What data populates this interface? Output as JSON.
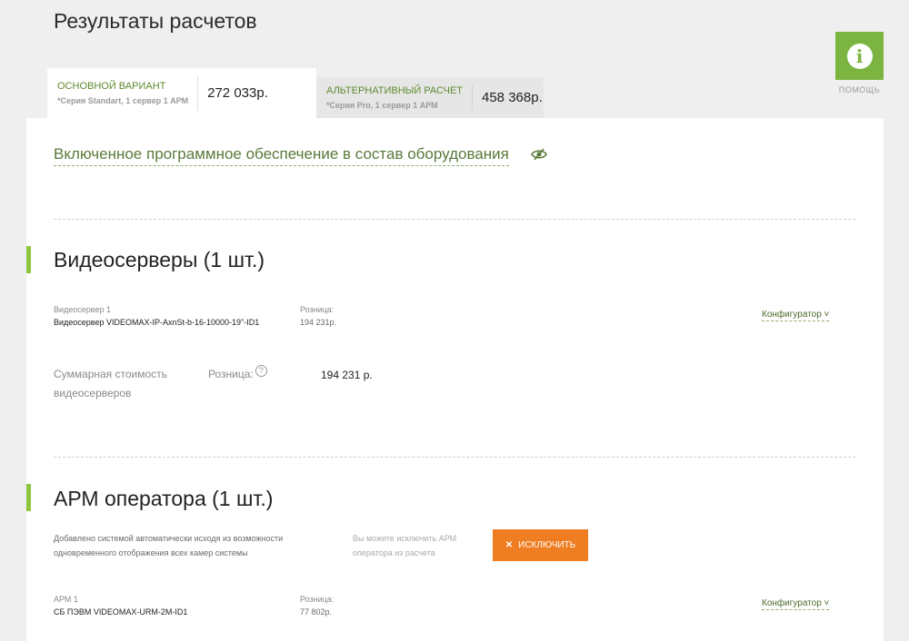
{
  "page": {
    "title": "Результаты расчетов"
  },
  "help": {
    "label": "ПОМОЩЬ",
    "icon": "info-icon",
    "color": "#7cb442"
  },
  "tabs": [
    {
      "name": "ОСНОВНОЙ ВАРИАНТ",
      "sub": "*Серия Standart, 1 сервер 1 АРМ",
      "price": "272 033р.",
      "active": true
    },
    {
      "name": "АЛЬТЕРНАТИВНЫЙ РАСЧЕТ",
      "sub": "*Серия Pro, 1 сервер 1 АРМ",
      "price": "458 368р.",
      "active": false
    }
  ],
  "software": {
    "link": "Включенное программное обеспечение в состав оборудования",
    "icon": "eye-icon"
  },
  "videoservers": {
    "title": "Видеосерверы  (1 шт.)",
    "item": {
      "label": "Видеосервер 1",
      "name": "Видеосервер VIDEOMAX-IP-AxnSt-b-16-10000-19\"-ID1",
      "price_label": "Розница:",
      "price": "194 231р.",
      "configurator": "Конфигуратор"
    },
    "total": {
      "label_line1": "Суммарная стоимость",
      "label_line2": "видеосерверов",
      "price_label": "Розница:",
      "price": "194 231 р."
    }
  },
  "arm": {
    "title": "АРМ оператора (1 шт.)",
    "note_line1": "Добавлено системой автоматически исходя из возможности",
    "note_line2": "одновременного отображения всех камер системы",
    "hint_line1": "Вы можете исключить АРМ",
    "hint_line2": "оператора из расчета",
    "exclude_button": "ИСКЛЮЧИТЬ",
    "button_color": "#ef7d22",
    "item": {
      "label": "АРМ 1",
      "name": "СБ ПЭВМ VIDEOMAX-URM-2M-ID1",
      "price_label": "Розница:",
      "price": "77 802р.",
      "configurator": "Конфигуратор"
    }
  }
}
